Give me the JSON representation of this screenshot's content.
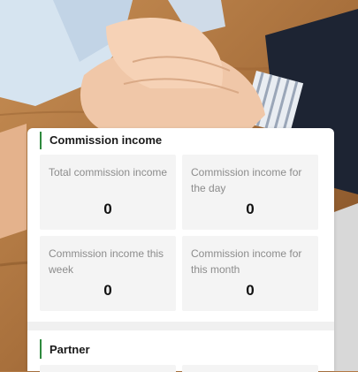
{
  "commission": {
    "title": "Commission income",
    "tiles": [
      {
        "label": "Total commission income",
        "value": "0"
      },
      {
        "label": "Commission income for the day",
        "value": "0"
      },
      {
        "label": "Commission income this week",
        "value": "0"
      },
      {
        "label": "Commission income for this month",
        "value": "0"
      }
    ]
  },
  "partner": {
    "title": "Partner"
  },
  "colors": {
    "accent_bar": "#2e8a3e",
    "tile_bg": "#f4f4f4",
    "label_text": "#8c8c8c"
  },
  "background": {
    "image": "stacked-hands-photo"
  }
}
